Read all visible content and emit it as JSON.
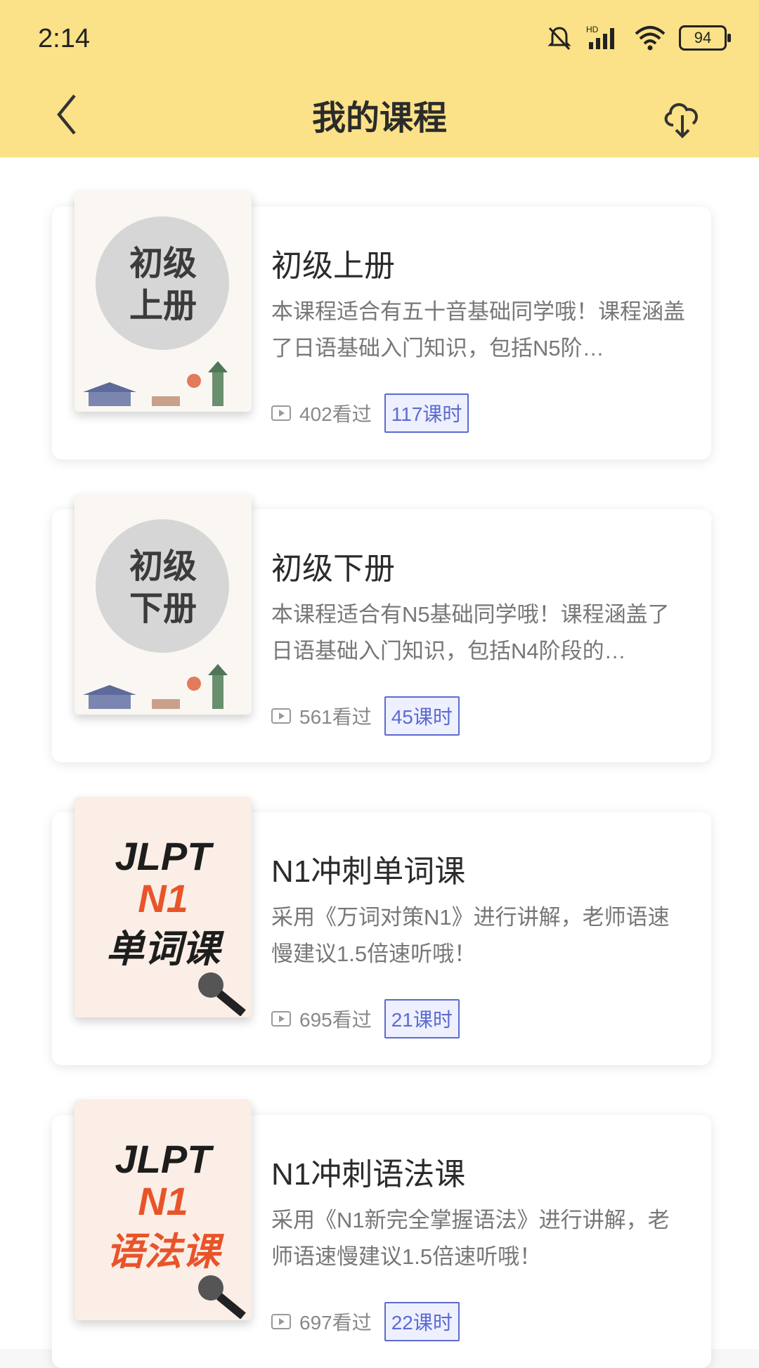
{
  "status": {
    "time": "2:14",
    "battery": "94"
  },
  "nav": {
    "title": "我的课程"
  },
  "courses": [
    {
      "thumb_lines": [
        "初级",
        "上册"
      ],
      "title": "初级上册",
      "desc": "本课程适合有五十音基础同学哦！课程涵盖了日语基础入门知识，包括N5阶…",
      "views": "402看过",
      "lessons": "117课时"
    },
    {
      "thumb_lines": [
        "初级",
        "下册"
      ],
      "title": "初级下册",
      "desc": "本课程适合有N5基础同学哦！课程涵盖了日语基础入门知识，包括N4阶段的…",
      "views": "561看过",
      "lessons": "45课时"
    },
    {
      "thumb_lines": [
        "JLPT",
        "N1",
        "单词课"
      ],
      "title": "N1冲刺单词课",
      "desc": "采用《万词对策N1》进行讲解，老师语速慢建议1.5倍速听哦！",
      "views": "695看过",
      "lessons": "21课时"
    },
    {
      "thumb_lines": [
        "JLPT",
        "N1",
        "语法课"
      ],
      "title": "N1冲刺语法课",
      "desc": "采用《N1新完全掌握语法》进行讲解，老师语速慢建议1.5倍速听哦！",
      "views": "697看过",
      "lessons": "22课时"
    }
  ],
  "icons": {
    "back": "chevron-left-icon",
    "download": "cloud-download-icon",
    "play": "play-icon",
    "status": [
      "mute-icon",
      "signal-icon",
      "wifi-icon",
      "battery-icon"
    ]
  },
  "colors": {
    "header": "#fbe187",
    "accent": "#5b6bd0",
    "jlpt_orange": "#e8542a"
  }
}
